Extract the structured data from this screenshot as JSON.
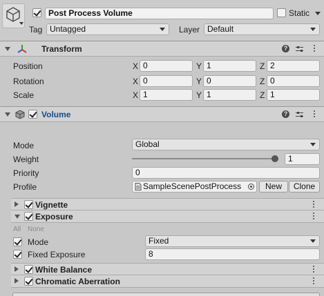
{
  "gameobject": {
    "icon": "cube-icon",
    "active": true,
    "name": "Post Process Volume",
    "static_label": "Static",
    "tag_label": "Tag",
    "tag_value": "Untagged",
    "layer_label": "Layer",
    "layer_value": "Default"
  },
  "transform": {
    "title": "Transform",
    "icon": "transform-axes-icon",
    "position_label": "Position",
    "rotation_label": "Rotation",
    "scale_label": "Scale",
    "axis_x": "X",
    "axis_y": "Y",
    "axis_z": "Z",
    "position": {
      "x": "0",
      "y": "1",
      "z": "2"
    },
    "rotation": {
      "x": "0",
      "y": "0",
      "z": "0"
    },
    "scale": {
      "x": "1",
      "y": "1",
      "z": "1"
    }
  },
  "volume": {
    "title": "Volume",
    "enabled": true,
    "mode_label": "Mode",
    "mode_value": "Global",
    "weight_label": "Weight",
    "weight_value": "1",
    "weight_fraction": 1,
    "priority_label": "Priority",
    "priority_value": "0",
    "profile_label": "Profile",
    "profile_value": "SampleScenePostProcess",
    "new_label": "New",
    "clone_label": "Clone"
  },
  "overrides": {
    "vignette": {
      "title": "Vignette",
      "enabled": true
    },
    "exposure": {
      "title": "Exposure",
      "enabled": true,
      "all_label": "All",
      "none_label": "None",
      "mode_label": "Mode",
      "mode_value": "Fixed",
      "fixed_exposure_label": "Fixed Exposure",
      "fixed_exposure_value": "8"
    },
    "white_balance": {
      "title": "White Balance",
      "enabled": true
    },
    "chromatic_aberration": {
      "title": "Chromatic Aberration",
      "enabled": true
    }
  },
  "colors": {
    "panel_bg": "#c8c8c8",
    "header_bg": "#cbcbcb",
    "component_header_bg": "#d6d6d6",
    "volume_title": "#1a4a8a",
    "slider_knob": "#555555"
  }
}
